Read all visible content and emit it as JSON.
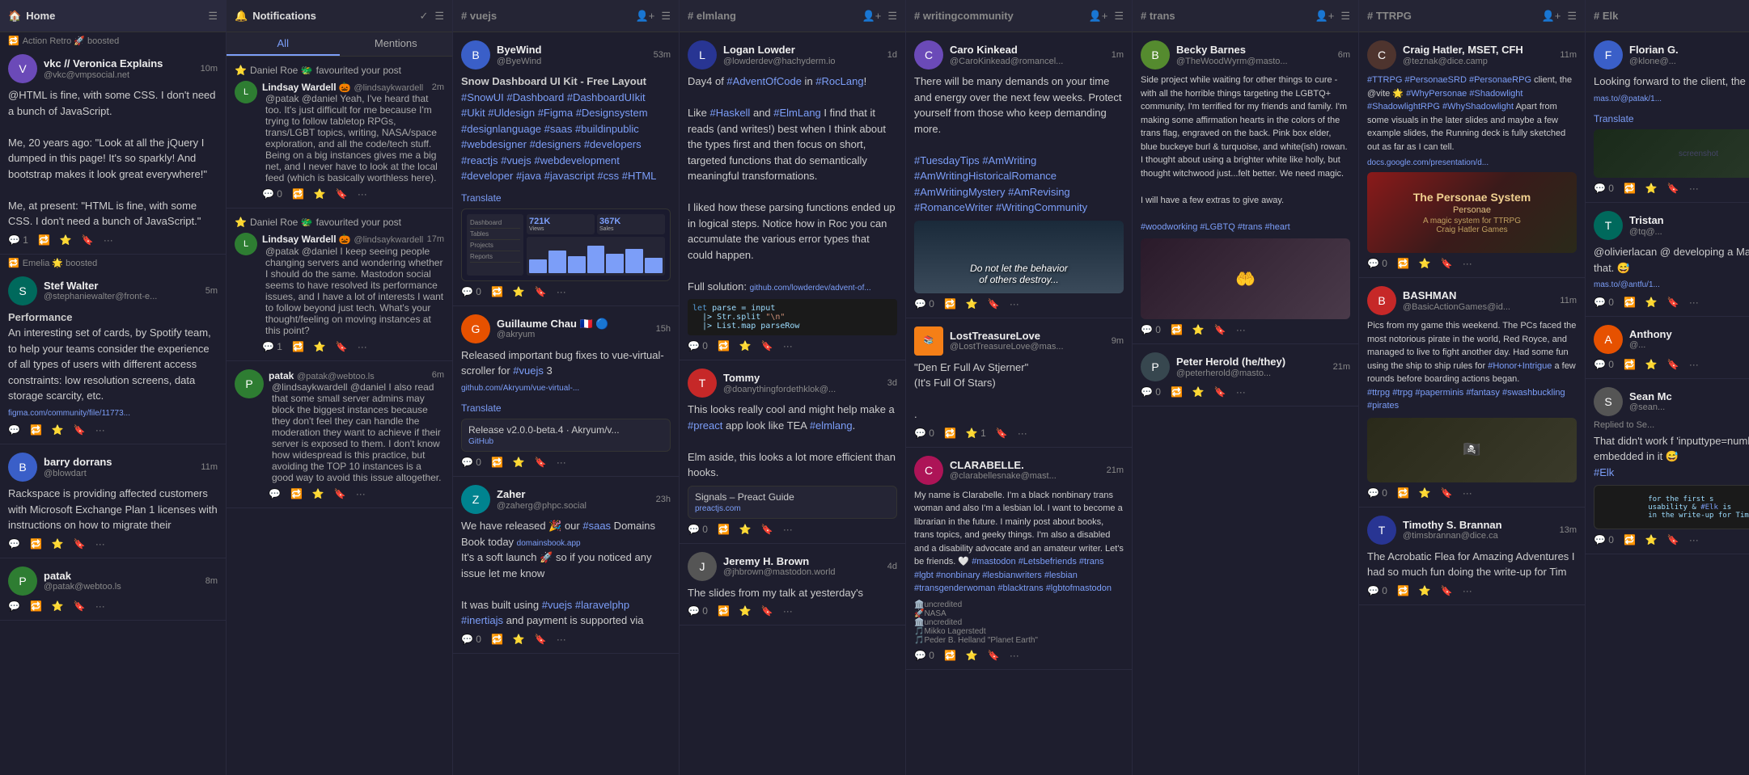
{
  "topBar": {
    "title": "Home",
    "icon": "home-icon"
  },
  "columns": [
    {
      "id": "home",
      "headerTitle": "Home",
      "headerIcon": "home-icon",
      "type": "home",
      "posts": [
        {
          "id": "h1",
          "boostBanner": "Action Retro 🚀 boosted",
          "userName": "vkc // Veronica Explains",
          "userHandle": "@vkc@vmpsocial.net",
          "avatarColor": "av-purple",
          "avatarInitial": "V",
          "time": "10m",
          "content": "@HTML is fine, with some CSS. I don't need a bunch of JavaScript.",
          "content2": "Me, 20 years ago: \"Look at all the jQuery I dumped in this page! It's so sparkly! And bootstrap makes it look great everywhere!\"",
          "content3": "Me, at present: \"HTML is fine, with some CSS. I don't need a bunch of JavaScript.\"",
          "actions": {
            "reply": 1,
            "boost": "",
            "star": "",
            "bookmark": ""
          }
        },
        {
          "id": "h2",
          "boostBanner": "Emelia 🌟 boosted",
          "userName": "Stef Walter",
          "userHandle": "@stephaniewalter@front-e...",
          "avatarColor": "av-teal",
          "avatarInitial": "S",
          "time": "5m",
          "contentLabel": "Performance",
          "content": "An interesting set of cards, by Spotify team, to help your teams consider the experience of all types of users with different access constraints: low resolution screens, data storage scarcity, etc.",
          "link": "figma.com/community/file/11773...",
          "actions": {
            "reply": "",
            "boost": "",
            "star": "",
            "bookmark": ""
          }
        },
        {
          "id": "h3",
          "boostBanner": "",
          "userName": "barry dorrans",
          "userHandle": "@blowdart",
          "avatarColor": "av-blue",
          "avatarInitial": "B",
          "time": "11m",
          "content": "Rackspace is providing affected customers with Microsoft Exchange Plan 1 licenses with instructions on how to migrate their",
          "actions": {
            "reply": "",
            "boost": "",
            "star": "",
            "bookmark": ""
          }
        },
        {
          "id": "h4",
          "boostBanner": "",
          "userName": "patak",
          "userHandle": "@patak@webtoo.ls",
          "avatarColor": "av-green",
          "avatarInitial": "P",
          "time": "8m",
          "content": "",
          "actions": {
            "reply": "",
            "boost": "",
            "star": "",
            "bookmark": ""
          }
        }
      ]
    },
    {
      "id": "notifications",
      "headerTitle": "Notifications",
      "headerIcon": "bell-icon",
      "type": "notifications",
      "tabs": [
        "All",
        "Mentions"
      ],
      "activeTab": "All",
      "items": [
        {
          "id": "n1",
          "type": "favourite",
          "starred": true,
          "actor": "Daniel Roe",
          "actorEmoji": "🐲",
          "action": "favourited your post",
          "subUser": "Lindsay Wardell 🎃",
          "subHandle": "@lindsaykwardell",
          "subTime": "2m",
          "subContent": "@patak @daniel Yeah, I've heard that too. It's just difficult for me because I'm trying to follow tabletop RPGs, trans/LGBT topics, writing, NASA/space exploration, and all the code/tech stuff. Being on a big instances gives me a big net, and I never have to look at the local feed (which is basically worthless here).",
          "actions": {
            "reply": 0,
            "boost": "",
            "star": "",
            "bookmark": ""
          }
        },
        {
          "id": "n2",
          "type": "favourite",
          "starred": true,
          "actor": "Daniel Roe",
          "actorEmoji": "🐲",
          "action": "favourited your post",
          "subUser": "Lindsay Wardell 🎃",
          "subHandle": "@lindsaykwardell",
          "subTime": "17m",
          "subContent": "@patak @daniel I keep seeing people changing servers and wondering whether I should do the same. Mastodon social seems to have resolved its performance issues, and I have a lot of interests I want to follow beyond just tech. What's your thought/feeling on moving instances at this point?",
          "actions": {
            "reply": 1,
            "boost": "",
            "star": "",
            "bookmark": ""
          }
        },
        {
          "id": "n3",
          "type": "mention",
          "actor": "patak",
          "actorHandle": "@patak@webtoo.ls",
          "avatarColor": "av-green",
          "avatarInitial": "P",
          "time": "6m",
          "content": "@lindsaykwardell @daniel I also read that some small server admins may block the biggest instances because they don't feel they can handle the moderation they want to achieve if their server is exposed to them. I don't know how widespread is this practice, but avoiding the TOP 10 instances is a good way to avoid this issue altogether.",
          "actions": {
            "reply": "",
            "boost": "",
            "star": "",
            "bookmark": ""
          }
        }
      ]
    },
    {
      "id": "vuejs",
      "headerTitle": "# vuejs",
      "headerIcon": "hashtag-icon",
      "type": "feed",
      "posts": [
        {
          "id": "v1",
          "userName": "ByeWind",
          "userHandle": "@ByeWind",
          "avatarColor": "av-blue",
          "avatarInitial": "B",
          "time": "53m",
          "title": "Snow Dashboard UI Kit - Free Layout",
          "content": "#SnowUI #Dashboard #DashboardUIkit #Ukit #Uldesign #Figma #Designsystem #designlanguage #saas #buildinpublic #webdesigner #designers #developers #reactjs #vuejs #webdevelopment #developer #java #javascript #css #HTML",
          "hasImage": true,
          "hasTranslate": true,
          "actions": {
            "reply": 0,
            "boost": "",
            "star": "",
            "bookmark": ""
          }
        },
        {
          "id": "v2",
          "userName": "Guillaume Chau",
          "userHandle": "@akryum",
          "avatarColor": "av-orange",
          "avatarInitial": "G",
          "time": "15h",
          "content": "Released important bug fixes to vue-virtual-scroller for #vuejs 3\ngithub.com/Akryum/vue-virtual-...",
          "hasTranslate": true,
          "linkPreview": {
            "title": "Release v2.0.0-beta.4 · Akryum/v...",
            "url": "GitHub"
          },
          "actions": {
            "reply": 0,
            "boost": "",
            "star": "",
            "bookmark": ""
          }
        },
        {
          "id": "v3",
          "userName": "Zaher",
          "userHandle": "@zaherg@phpc.social",
          "avatarColor": "av-cyan",
          "avatarInitial": "Z",
          "time": "23h",
          "content": "We have released 🎉 our #saas Domains Book today domainsbook.app\nIt's a soft launch 🚀 so if you noticed any issue let me know\n\nIt was built using #vuejs #laravelphp #inertiajs and payment is supported via",
          "actions": {
            "reply": 0,
            "boost": "",
            "star": "",
            "bookmark": ""
          }
        }
      ]
    },
    {
      "id": "elmlang",
      "headerTitle": "# elmlang",
      "headerIcon": "hashtag-icon",
      "type": "feed",
      "posts": [
        {
          "id": "e1",
          "userName": "Logan Lowder",
          "userHandle": "@lowderdev@hachyderm.io",
          "avatarColor": "av-indigo",
          "avatarInitial": "L",
          "time": "1d",
          "content": "Day4 of #AdventOfCode in #RocLang!\n\nLike #Haskell and #ElmLang I find that it reads (and writes!) best when I think about the types first and then focus on short, targeted functions that do semantically meaningful transformations.\n\nI liked how these parsing functions ended up in logical steps. Notice how in Roc you can accumulate the various error types that could happen.\n\nFull solution: github.com/lowderdev/advent-of...",
          "hasCodeImage": true,
          "actions": {
            "reply": 0,
            "boost": "",
            "star": "",
            "bookmark": ""
          }
        },
        {
          "id": "e2",
          "userName": "Tommy",
          "userHandle": "@doanythingfordethklok@...",
          "avatarColor": "av-red",
          "avatarInitial": "T",
          "time": "3d",
          "content": "This looks really cool and might help make a #preact app look like TEA #elmlang.\n\nElm aside, this looks a lot more efficient than hooks.",
          "linkPreview": {
            "title": "Signals – Preact Guide",
            "url": "preactjs.com"
          },
          "actions": {
            "reply": 0,
            "boost": "",
            "star": "",
            "bookmark": ""
          }
        },
        {
          "id": "e3",
          "userName": "Jeremy H. Brown",
          "userHandle": "@jhbrown@mastodon.world",
          "avatarColor": "av-gray",
          "avatarInitial": "J",
          "time": "4d",
          "content": "The slides from my talk at yesterday's",
          "actions": {
            "reply": 0,
            "boost": "",
            "star": "",
            "bookmark": ""
          }
        }
      ]
    },
    {
      "id": "writingcommunity",
      "headerTitle": "# writingcommunity",
      "headerIcon": "hashtag-icon",
      "type": "feed",
      "posts": [
        {
          "id": "w1",
          "userName": "Caro Kinkead",
          "userHandle": "@CaroKinkead@romancel...",
          "avatarColor": "av-purple",
          "avatarInitial": "C",
          "time": "1m",
          "content": "There will be many demands on your time and energy over the next few weeks. Protect yourself from those who keep demanding more.\n\n#TuesdayTips #AmWriting #AmWritingHistoricalRomance #AmWritingMystery #AmRevising #RomanceWriter #WritingCommunity",
          "hasSceneImage": true,
          "actions": {
            "reply": 0,
            "boost": "",
            "star": "",
            "bookmark": ""
          }
        },
        {
          "id": "w2",
          "userName": "LostTreasureLove",
          "userHandle": "@LostTreasureLove@mas...",
          "avatarColor": "av-amber",
          "avatarInitial": "L",
          "time": "9m",
          "content": "\"Den Er Full Av Stjerner\"\n(It's Full Of Stars)\n\n.",
          "actions": {
            "reply": 0,
            "boost": "",
            "star": "1",
            "bookmark": ""
          }
        },
        {
          "id": "w3",
          "userName": "CLARABELLE.",
          "userHandle": "@clarabellesnake@mast...",
          "avatarColor": "av-pink",
          "avatarInitial": "C",
          "time": "21m",
          "content": "My name is Clarabelle. I'm a black nonbinary trans woman and also I'm a lesbian lol. I want to become a librarian in the future. I mainly post about books, trans topics, and geeky things. I'm also a disabled and a disability advocate and an amateur writer. Let's be friends. 🤍 #mastodon #Letsbefriends #trans #lgbt #nonbinary #lesbianwriters #lesbian #transgenderwoman #blacktrans #lgbtofmastodon",
          "actions": {
            "reply": 0,
            "boost": "",
            "star": "",
            "bookmark": ""
          }
        }
      ]
    },
    {
      "id": "trans",
      "headerTitle": "# trans",
      "headerIcon": "hashtag-icon",
      "type": "feed",
      "posts": [
        {
          "id": "t1",
          "userName": "Becky Barnes",
          "userHandle": "@TheWoodWyrm@masto...",
          "avatarColor": "av-lime",
          "avatarInitial": "B",
          "time": "6m",
          "content": "Side project while waiting for other things to cure - with all the horrible things targeting the LGBTQ+ community, I'm terrified for my friends and family. I'm making some affirmation hearts in the colors of the trans flag, engraved on the back. Pink box elder, blue buckeye burl & turquoise, and white(ish) rowan. I thought about using a brighter white like holly, but thought witchwood just...felt better. We need magic.\n\nI will have a few extras to give away.\n\n#woodworking #LGBTQ #trans #heart",
          "hasHandsImage": true,
          "actions": {
            "reply": 0,
            "boost": "",
            "star": "",
            "bookmark": ""
          }
        },
        {
          "id": "t2",
          "userName": "Peter Herold (he/they)",
          "userHandle": "@peterherold@masto...",
          "avatarColor": "av-deep",
          "avatarInitial": "P",
          "time": "21m",
          "content": "",
          "actions": {
            "reply": 0,
            "boost": "",
            "star": "",
            "bookmark": ""
          }
        }
      ]
    },
    {
      "id": "ttrpg",
      "headerTitle": "# TTRPG",
      "headerIcon": "hashtag-icon",
      "type": "feed",
      "posts": [
        {
          "id": "tr1",
          "userName": "Craig Hatler, MSET, CFH",
          "userHandle": "@teznak@dice.camp",
          "avatarColor": "av-brown",
          "avatarInitial": "C",
          "time": "11m",
          "content": "#TTRPG #PersonaeSRD #PersonaeRPG client, the @vite 🌟 #WhyPersonae #Shadowlight #ShadowlightRPG #WhyShadowlight Apart from some visuals in the later slides and maybe a few example slides, the Running deck is fully sketched out as far as I can tell.",
          "linkUrl": "docs.google.com/presentation/d...",
          "hasPersonaeCard": true,
          "actions": {
            "reply": 0,
            "boost": "",
            "star": "",
            "bookmark": ""
          }
        },
        {
          "id": "tr2",
          "userName": "BASHMAN",
          "userHandle": "@BasicActionGames@id...",
          "avatarColor": "av-red",
          "avatarInitial": "B",
          "time": "11m",
          "content": "Pics from my game this weekend. The PCs faced the most notorious pirate in the world, Red Royce, and managed to live to fight another day. Had some fun using the ship to ship rules for #Honor+Intrigue a few rounds before boarding actions began.\n#ttrpg #trpg #paperminis #fantasy #swashbuckling #pirates",
          "hasGameImage": true,
          "actions": {
            "reply": 0,
            "boost": "",
            "star": "",
            "bookmark": ""
          }
        },
        {
          "id": "tr3",
          "userName": "Timothy S. Brannan",
          "userHandle": "@timsbrannan@dice.ca",
          "avatarColor": "av-indigo",
          "avatarInitial": "T",
          "time": "13m",
          "content": "The Acrobatic Flea for Amazing Adventures I had so much fun doing the write-up for Tim",
          "actions": {
            "reply": 0,
            "boost": "",
            "star": "",
            "bookmark": ""
          }
        }
      ]
    },
    {
      "id": "elk",
      "headerTitle": "# Elk",
      "headerIcon": "hashtag-icon",
      "type": "feed",
      "posts": [
        {
          "id": "elk1",
          "userName": "Florian G.",
          "userHandle": "@klone@...",
          "avatarColor": "av-blue",
          "avatarInitial": "F",
          "time": "",
          "content": "Looking forward to the client, the @vite",
          "linkUrl": "mas.to/@patak/1...",
          "hasTranslate": true,
          "actions": {
            "reply": 0,
            "boost": "",
            "star": "",
            "bookmark": ""
          }
        },
        {
          "id": "elk2",
          "userName": "Tristan",
          "userHandle": "@tq@...",
          "avatarColor": "av-teal",
          "avatarInitial": "T",
          "time": "",
          "content": "@olivierlacan @ developing a Mas allow that. 😅\nmas.to/@antfu/1...",
          "actions": {
            "reply": 0,
            "boost": "",
            "star": "",
            "bookmark": ""
          }
        },
        {
          "id": "elk3",
          "userName": "Anthony",
          "userHandle": "@...",
          "avatarColor": "av-orange",
          "avatarInitial": "A",
          "time": "",
          "content": "",
          "actions": {
            "reply": 0,
            "boost": "",
            "star": "",
            "bookmark": ""
          }
        },
        {
          "id": "elk4",
          "userName": "Sean Mc",
          "userHandle": "@sean...",
          "avatarColor": "av-gray",
          "avatarInitial": "S",
          "time": "",
          "repliedTo": "Replied to Se...",
          "content": "That didn't work f 'inputtype=numb embedded in it 😅",
          "content2": "#Elk",
          "actions": {
            "reply": 0,
            "boost": "",
            "star": "",
            "bookmark": ""
          }
        }
      ]
    }
  ]
}
